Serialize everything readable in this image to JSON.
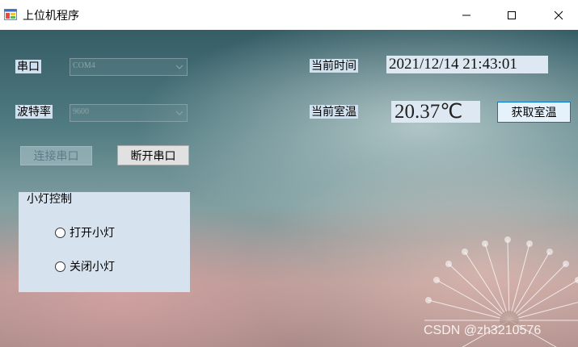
{
  "window": {
    "title": "上位机程序",
    "icon": "app-form-icon",
    "controls": {
      "minimize_icon": "minimize-icon",
      "maximize_icon": "maximize-icon",
      "close_icon": "close-icon"
    }
  },
  "serial": {
    "port_label": "串口",
    "port_value": "COM4",
    "baud_label": "波特率",
    "baud_value": "9600",
    "connect_label": "连接串口",
    "disconnect_label": "断开串口"
  },
  "status": {
    "time_label": "当前时间",
    "time_value": "2021/12/14 21:43:01",
    "temp_label": "当前室温",
    "temp_value": "20.37℃",
    "get_temp_label": "获取室温"
  },
  "light": {
    "group_title": "小灯控制",
    "on_label": "打开小灯",
    "off_label": "关闭小灯"
  },
  "watermark": "CSDN @zh3210576",
  "colors": {
    "label_bg": "#cfe0ee",
    "value_bg": "#dde8f2",
    "group_bg": "#d6e3ef",
    "button_focus_border": "#0078d7"
  }
}
